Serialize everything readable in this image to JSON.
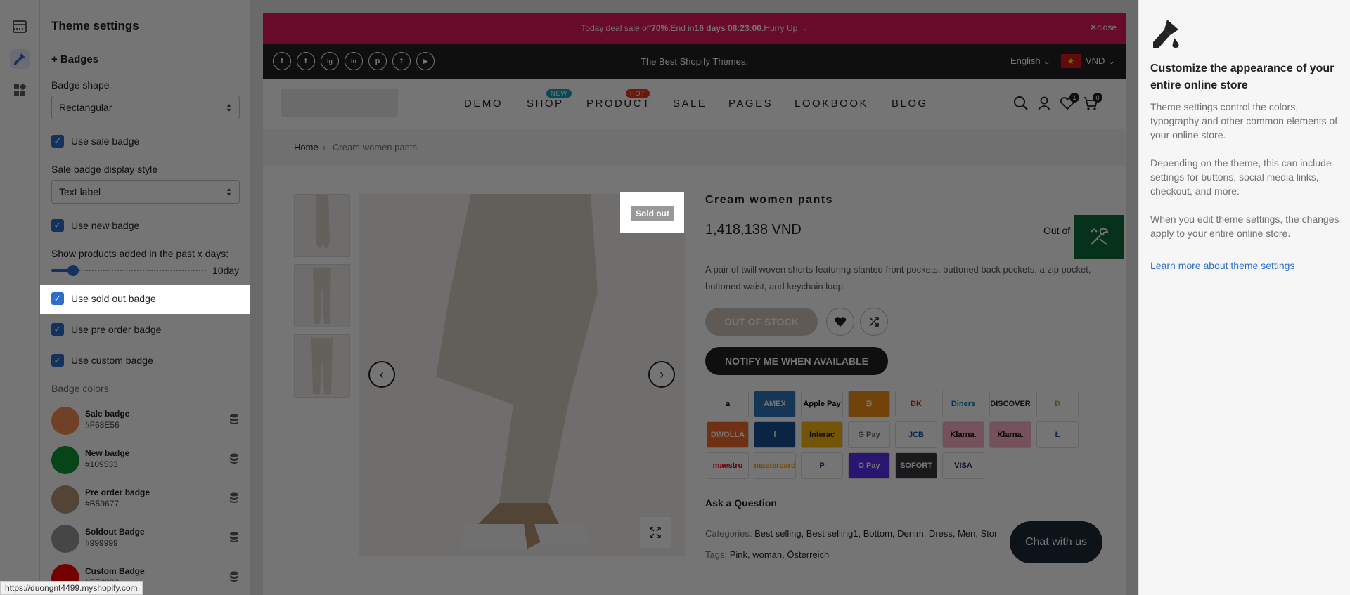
{
  "rail": {
    "items": [
      "sections",
      "theme-settings",
      "app-blocks"
    ]
  },
  "panel": {
    "title": "Theme settings",
    "section": "+ Badges",
    "badge_shape": {
      "label": "Badge shape",
      "value": "Rectangular"
    },
    "use_sale_badge": "Use sale badge",
    "sale_display": {
      "label": "Sale badge display style",
      "value": "Text label"
    },
    "use_new_badge": "Use new badge",
    "past_days": {
      "label": "Show products added in the past x days:",
      "value": "10day",
      "fraction": 0.14
    },
    "use_sold_out_badge": "Use sold out badge",
    "use_pre_order_badge": "Use pre order badge",
    "use_custom_badge": "Use custom badge",
    "colors_heading": "Badge colors",
    "colors": [
      {
        "name": "Sale badge",
        "hex": "#F68E56"
      },
      {
        "name": "New badge",
        "hex": "#109533"
      },
      {
        "name": "Pre order badge",
        "hex": "#B59677"
      },
      {
        "name": "Soldout Badge",
        "hex": "#999999"
      },
      {
        "name": "Custom Badge",
        "hex": "#FF0000"
      }
    ]
  },
  "store": {
    "announce": {
      "prefix": "Today deal sale off ",
      "percent": "70%.",
      "mid": " End in ",
      "countdown": "16 days 08:23:00.",
      "suffix": " Hurry Up →",
      "close": "close"
    },
    "tagline": "The Best Shopify Themes.",
    "language": "English",
    "flag": "★",
    "currency": "VND",
    "social": [
      "f",
      "t",
      "ig",
      "in",
      "p",
      "t",
      "▶"
    ],
    "nav": [
      {
        "label": "DEMO"
      },
      {
        "label": "SHOP",
        "badge": "NEW",
        "badge_color": "#17a2b8"
      },
      {
        "label": "PRODUCT",
        "badge": "HOT",
        "badge_color": "#e2351b"
      },
      {
        "label": "SALE"
      },
      {
        "label": "PAGES"
      },
      {
        "label": "LOOKBOOK"
      },
      {
        "label": "BLOG"
      }
    ],
    "wishlist_count": "1",
    "cart_count": "0",
    "breadcrumb": {
      "home": "Home",
      "sep": "›",
      "current": "Cream women pants"
    },
    "product": {
      "sold_out": "Sold out",
      "title": "Cream women pants",
      "price": "1,418,138 VND",
      "stock": "Out of",
      "description": "A pair of twill woven shorts featuring slanted front pockets, buttoned back pockets, a zip pocket, buttoned waist, and keychain loop.",
      "out_of_stock": "OUT OF STOCK",
      "notify": "NOTIFY ME WHEN AVAILABLE",
      "payments": [
        "a",
        "AMEX",
        "Apple Pay",
        "₿",
        "DK",
        "Diners",
        "DISCOVER",
        "Ð",
        "DWOLLA",
        "f",
        "Interac",
        "G Pay",
        "JCB",
        "Klarna.",
        "Klarna.",
        "Ł",
        "maestro",
        "mastercard",
        "P",
        "O Pay",
        "SOFORT",
        "VISA"
      ],
      "ask": "Ask a Question",
      "categories_label": "Categories: ",
      "categories": "Best selling, Best selling1, Bottom, Denim, Dress, Men, Stor",
      "tags_label": "Tags: ",
      "tags": "Pink, woman, Österreich"
    },
    "chat": "Chat with us"
  },
  "help": {
    "title": "Customize the appearance of your entire online store",
    "p1": "Theme settings control the colors, typography and other common elements of your online store.",
    "p2": "Depending on the theme, this can include settings for buttons, social media links, checkout, and more.",
    "p3": "When you edit theme settings, the changes apply to your entire online store.",
    "link": "Learn more about theme settings"
  },
  "status_url": "https://duongnt4499.myshopify.com"
}
